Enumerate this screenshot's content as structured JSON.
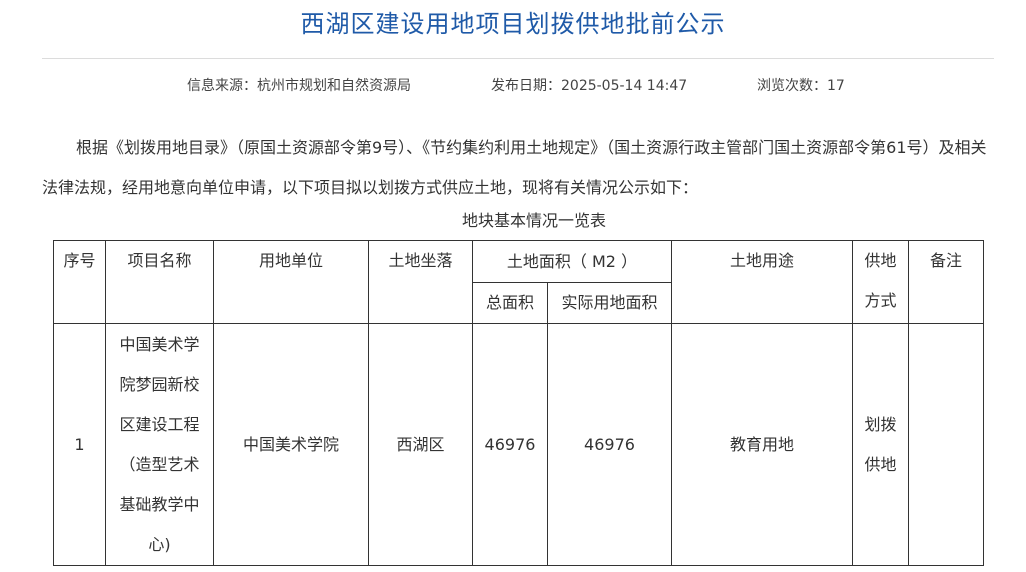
{
  "page": {
    "title": "西湖区建设用地项目划拨供地批前公示",
    "meta": {
      "source": "信息来源：杭州市规划和自然资源局",
      "date": "发布日期：2025-05-14 14:47",
      "views": "浏览次数：17"
    },
    "paragraph": "根据《划拨用地目录》（原国土资源部令第9号）、《节约集约利用土地规定》（国土资源行政主管部门国土资源部令第61号）及相关法律法规，经用地意向单位申请，以下项目拟以划拨方式供应土地，现将有关情况公示如下：",
    "table_caption": "地块基本情况一览表"
  },
  "table": {
    "headers": {
      "seq": "序号",
      "project": "项目名称",
      "unit": "用地单位",
      "location": "土地坐落",
      "area": "土地面积（ M2 ）",
      "total_area": "总面积",
      "actual_area": "实际用地面积",
      "use": "土地用途",
      "supply": "供地方式",
      "remark": "备注"
    },
    "rows": [
      {
        "seq": "1",
        "project": "中国美术学院梦园新校区建设工程（造型艺术基础教学中心)",
        "unit": "中国美术学院",
        "location": "西湖区",
        "total_area": "46976",
        "actual_area": "46976",
        "use": "教育用地",
        "supply": "划拨供地",
        "remark": ""
      }
    ]
  }
}
